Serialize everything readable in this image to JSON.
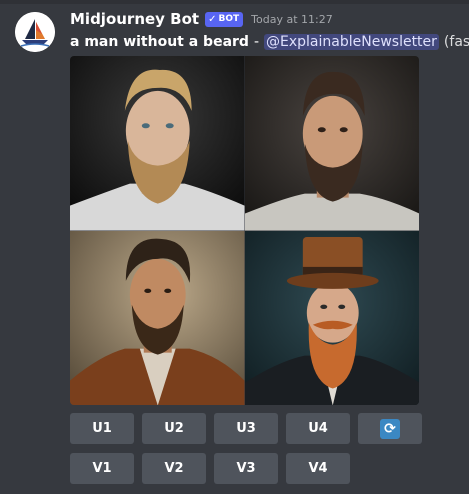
{
  "message": {
    "username": "Midjourney Bot",
    "bot_badge": "BOT",
    "bot_badge_check": "✓",
    "timestamp": "Today at 11:27",
    "prompt": "a man without a beard",
    "separator": "-",
    "mention": "@ExplainableNewsletter",
    "speed": "(fast)"
  },
  "image_grid": {
    "images": [
      {
        "description": "blond bearded man in white t-shirt, dark background",
        "icon": "portrait-image"
      },
      {
        "description": "dark-haired bearded man in light t-shirt",
        "icon": "portrait-image"
      },
      {
        "description": "painted portrait of bearded man in brown jacket",
        "icon": "portrait-image"
      },
      {
        "description": "man with ginger beard and brown top hat",
        "icon": "portrait-image"
      }
    ]
  },
  "buttons": {
    "upscale": [
      "U1",
      "U2",
      "U3",
      "U4"
    ],
    "variation": [
      "V1",
      "V2",
      "V3",
      "V4"
    ],
    "reroll_icon": "refresh-icon",
    "reroll_glyph": "🔄"
  },
  "colors": {
    "background": "#36393f",
    "button": "#4f545c",
    "bot_badge": "#5865f2",
    "mention_bg": "#414675",
    "reroll_icon": "#3b88c3"
  }
}
